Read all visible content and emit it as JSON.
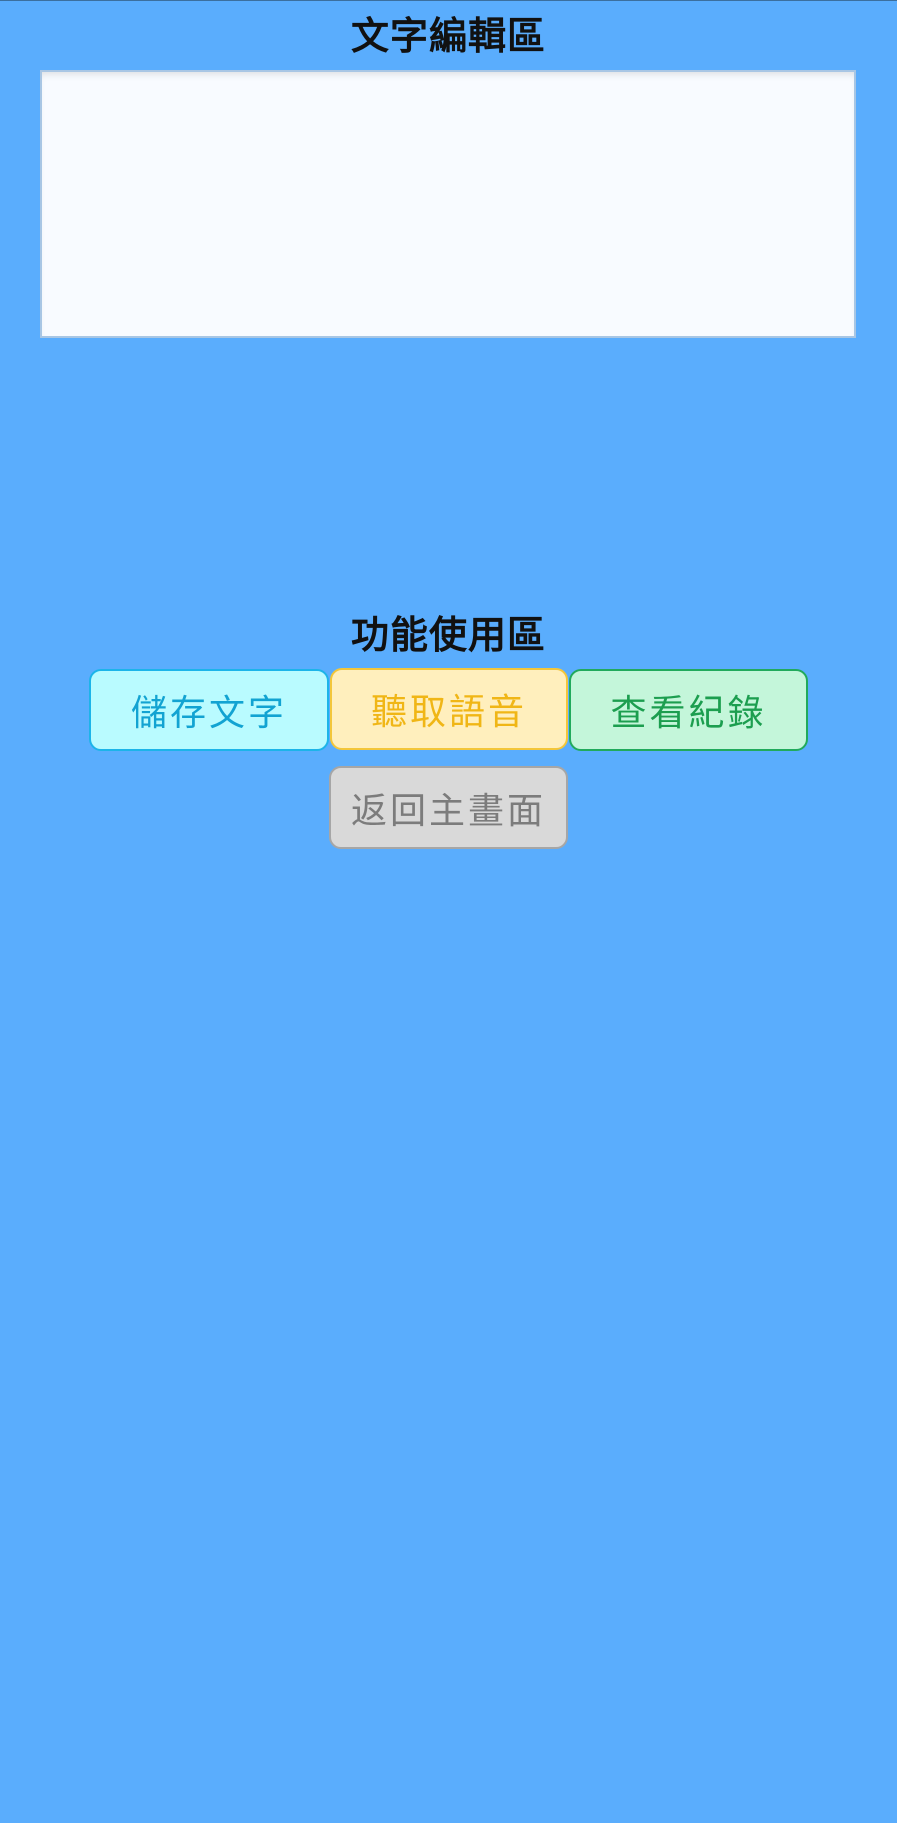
{
  "editor": {
    "title": "文字編輯區",
    "value": ""
  },
  "functions": {
    "title": "功能使用區",
    "buttons": {
      "save": "儲存文字",
      "listen": "聽取語音",
      "records": "查看紀錄",
      "home": "返回主畫面"
    }
  },
  "colors": {
    "background": "#5aadfd",
    "save_bg": "#b9fbff",
    "save_text": "#12a3d2",
    "listen_bg": "#ffefbd",
    "listen_text": "#f0b616",
    "records_bg": "#c4f6da",
    "records_text": "#1c9e4f",
    "home_bg": "#d9d9d9",
    "home_text": "#7c7c7c"
  }
}
